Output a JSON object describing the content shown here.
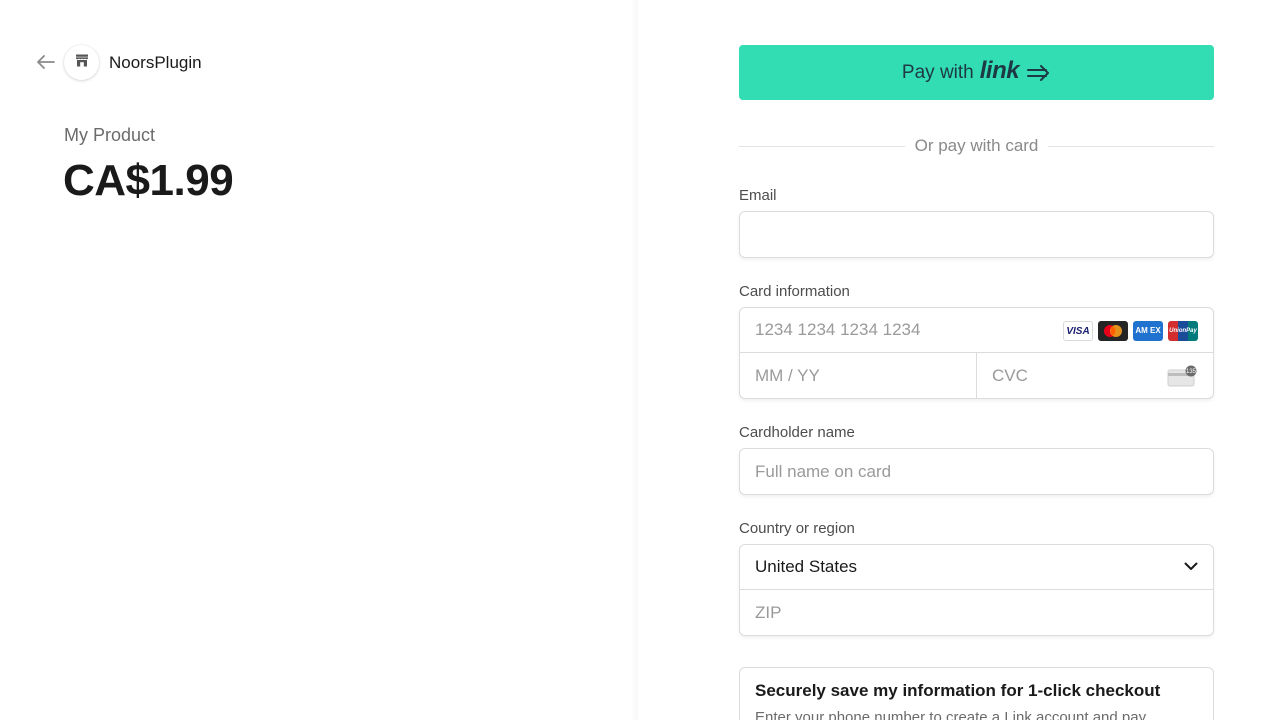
{
  "merchant": {
    "name": "NoorsPlugin"
  },
  "product": {
    "name": "My Product",
    "price": "CA$1.99"
  },
  "payment": {
    "link_button": {
      "prefix": "Pay with",
      "brand": "link"
    },
    "divider_text": "Or pay with card",
    "email": {
      "label": "Email",
      "value": "",
      "placeholder": ""
    },
    "card": {
      "label": "Card information",
      "number_placeholder": "1234 1234 1234 1234",
      "expiry_placeholder": "MM / YY",
      "cvc_placeholder": "CVC",
      "brands": [
        {
          "name": "visa",
          "text": "VISA"
        },
        {
          "name": "mastercard",
          "text": ""
        },
        {
          "name": "amex",
          "text": "AM EX"
        },
        {
          "name": "unionpay",
          "text": "UnionPay"
        }
      ],
      "cvc_hint": "135"
    },
    "cardholder": {
      "label": "Cardholder name",
      "placeholder": "Full name on card"
    },
    "country": {
      "label": "Country or region",
      "selected": "United States",
      "zip_placeholder": "ZIP"
    },
    "save_info": {
      "title": "Securely save my information for 1-click checkout",
      "description": "Enter your phone number to create a Link account and pay"
    }
  },
  "colors": {
    "link_green": "#33ddb3",
    "link_text": "#1d3944",
    "muted_text": "#6b6b6b",
    "border": "#dcdcdc"
  }
}
